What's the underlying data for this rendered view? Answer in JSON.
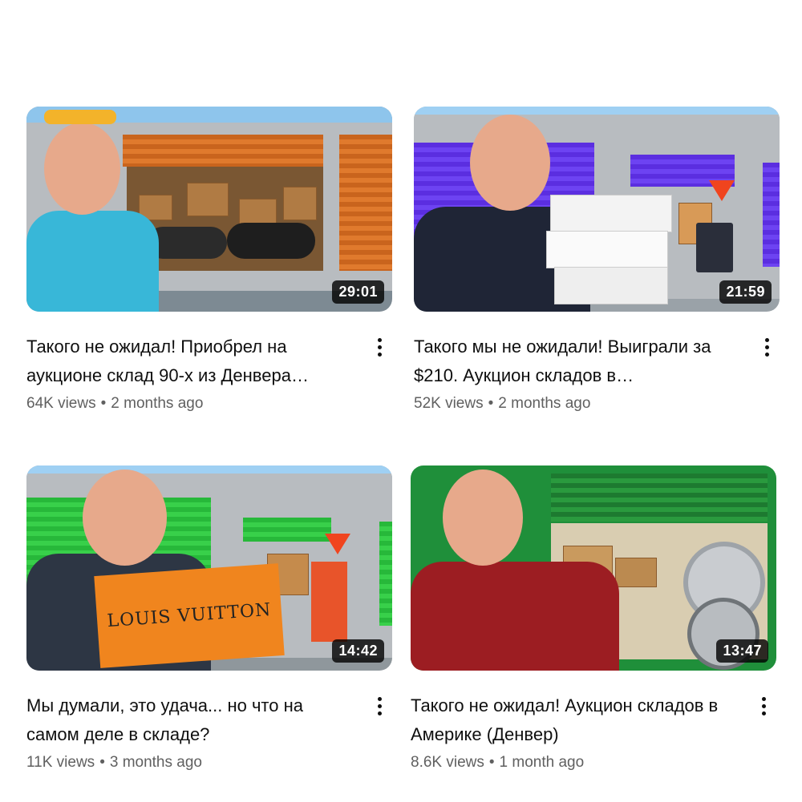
{
  "videos": [
    {
      "title": "Такого не ожидал! Приобрел на аукционе склад 90-х из Денвера…",
      "duration": "29:01",
      "views": "64K views",
      "age": "2 months ago"
    },
    {
      "title": "Такого мы не ожидали! Выиграли за $210. Аукцион складов в…",
      "duration": "21:59",
      "views": "52K views",
      "age": "2 months ago"
    },
    {
      "title": "Мы думали, это удача... но что на самом деле в складе?",
      "duration": "14:42",
      "views": "11K views",
      "age": "3 months ago",
      "thumb_text": "LOUIS VUITTON"
    },
    {
      "title": "Такого не ожидал! Аукцион складов в Америке (Денвер)",
      "duration": "13:47",
      "views": "8.6K views",
      "age": "1 month ago"
    }
  ],
  "separator": "•",
  "colors": {
    "duration_bg": "#000000cc",
    "meta_text": "#606060",
    "title_text": "#0f0f0f"
  },
  "icons": {
    "menu": "kebab-menu-icon"
  }
}
